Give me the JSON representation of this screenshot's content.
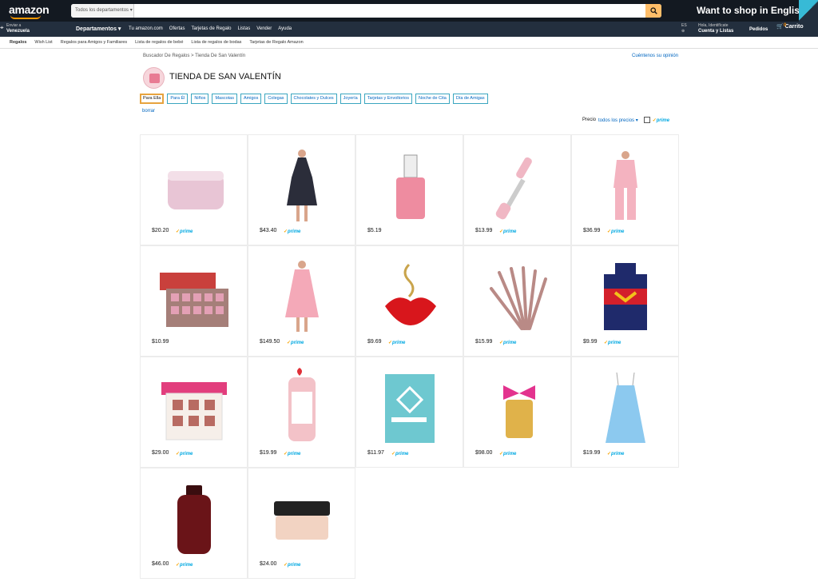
{
  "header": {
    "logo": "amazon",
    "search_dept": "Todos los departamentos",
    "search_placeholder": "",
    "promo": "Want to shop in English?"
  },
  "nav": {
    "deliver_line1": "Enviar a",
    "deliver_line2": "Venezuela",
    "departments": "Departamentos",
    "links": [
      "Tu amazon.com",
      "Ofertas",
      "Tarjetas de Regalo",
      "Listas",
      "Vender",
      "Ayuda"
    ],
    "lang": "ES",
    "account_line1": "Hola, Identifícate",
    "account_line2": "Cuenta y Listas",
    "orders": "Pedidos",
    "cart_count": "0",
    "cart": "Carrito"
  },
  "subnav": [
    "Regalos",
    "Wish List",
    "Regalos para Amigos y Familiares",
    "Lista de regalos de bebé",
    "Lista de regalos de bodas",
    "Tarjetas de Regalo Amazon"
  ],
  "breadcrumb": "Buscador De Regalos > Tienda De San Valentín",
  "feedback": "Cuéntenos su opinión",
  "store_title": "TIENDA DE SAN VALENTÍN",
  "chips": [
    "Para Ella",
    "Para Él",
    "Niños",
    "Mascotas",
    "Amigos",
    "Colegas",
    "Chocolates y Dulces",
    "Joyería",
    "Tarjetas y Envoltorios",
    "Noche de Cita",
    "Día de Amigas"
  ],
  "clear": "borrar",
  "price_filter": {
    "label": "Precio",
    "value": "todos los precios",
    "prime": "prime"
  },
  "products": [
    {
      "name": "cream-jar",
      "price": "$20.20",
      "prime": true,
      "color": "#e8c5d5"
    },
    {
      "name": "floral-dress",
      "price": "$43.40",
      "prime": true,
      "color": "#2b2d3a"
    },
    {
      "name": "nail-polish",
      "price": "$5.19",
      "prime": false,
      "color": "#ee8ca0"
    },
    {
      "name": "jade-roller",
      "price": "$13.99",
      "prime": true,
      "color": "#f0b7c4"
    },
    {
      "name": "pink-pajamas",
      "price": "$36.99",
      "prime": true,
      "color": "#f4b3c0"
    },
    {
      "name": "dreamland-palette",
      "price": "$10.99",
      "prime": false,
      "color": "#c9403c"
    },
    {
      "name": "pink-dress",
      "price": "$149.50",
      "prime": true,
      "color": "#f4a9b8"
    },
    {
      "name": "lips-necklace",
      "price": "$9.69",
      "prime": true,
      "color": "#d8161c"
    },
    {
      "name": "brush-set",
      "price": "$15.99",
      "prime": true,
      "color": "#b98a86"
    },
    {
      "name": "wonder-apron",
      "price": "$9.99",
      "prime": true,
      "color": "#1f2a6b"
    },
    {
      "name": "eyeshadow-palette",
      "price": "$29.00",
      "prime": true,
      "color": "#e23e7d"
    },
    {
      "name": "lotion-bottle",
      "price": "$19.99",
      "prime": true,
      "color": "#f3c2c8"
    },
    {
      "name": "relationship-book",
      "price": "$11.97",
      "prime": true,
      "color": "#6ec8d0"
    },
    {
      "name": "perfume-bottle",
      "price": "$98.00",
      "prime": true,
      "color": "#e0b24a"
    },
    {
      "name": "blue-slip-dress",
      "price": "$19.99",
      "prime": true,
      "color": "#8cc9ef"
    },
    {
      "name": "oribe-shampoo",
      "price": "$46.00",
      "prime": true,
      "color": "#6a1418"
    },
    {
      "name": "luxury-cream-jar",
      "price": "$24.00",
      "prime": true,
      "color": "#f2d3c2"
    }
  ]
}
